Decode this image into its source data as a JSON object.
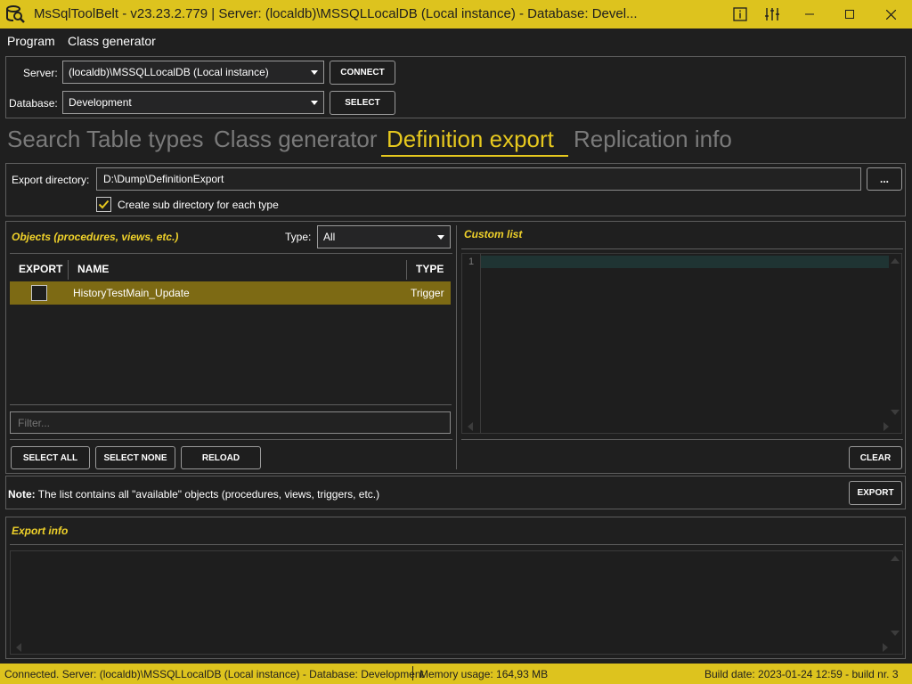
{
  "window": {
    "title": "MsSqlToolBelt - v23.23.2.779 | Server: (localdb)\\MSSQLLocalDB (Local instance) - Database: Devel...",
    "icons": [
      "app-logo-icon",
      "info-icon",
      "settings-sliders-icon",
      "minimize-icon",
      "maximize-icon",
      "close-icon"
    ]
  },
  "menu": {
    "items": [
      "Program",
      "Class generator"
    ]
  },
  "connection": {
    "server_label": "Server:",
    "server_value": "(localdb)\\MSSQLLocalDB (Local instance)",
    "connect_label": "CONNECT",
    "database_label": "Database:",
    "database_value": "Development",
    "select_label": "SELECT"
  },
  "tabs": [
    {
      "label": "Search",
      "active": false
    },
    {
      "label": "Table types",
      "active": false
    },
    {
      "label": "Class generator",
      "active": false
    },
    {
      "label": "Definition export",
      "active": true
    },
    {
      "label": "Replication info",
      "active": false
    }
  ],
  "export_dir": {
    "label": "Export directory:",
    "value": "D:\\Dump\\DefinitionExport",
    "browse_label": "...",
    "subdir_label": "Create sub directory for each type",
    "subdir_checked": true
  },
  "objects": {
    "title": "Objects (procedures, views, etc.)",
    "type_label": "Type:",
    "type_value": "All",
    "columns": [
      "EXPORT",
      "NAME",
      "TYPE"
    ],
    "rows": [
      {
        "export": false,
        "name": "HistoryTestMain_Update",
        "type": "Trigger",
        "selected": true
      }
    ],
    "filter_placeholder": "Filter...",
    "select_all": "SELECT ALL",
    "select_none": "SELECT NONE",
    "reload": "RELOAD"
  },
  "custom_list": {
    "title": "Custom list",
    "line_number": "1",
    "clear_label": "CLEAR"
  },
  "note": {
    "bold": "Note:",
    "text": " The list contains all \"available\" objects (procedures, views, triggers, etc.)",
    "export_label": "EXPORT"
  },
  "export_info": {
    "title": "Export info"
  },
  "statusbar": {
    "connection": "Connected. Server: (localdb)\\MSSQLLocalDB (Local instance) - Database: Development",
    "memory": "Memory usage: 164,93 MB",
    "build": "Build date: 2023-01-24 12:59 - build nr. 3"
  },
  "colors": {
    "accent": "#ddc31e",
    "background": "#1f1f1f",
    "selected_row": "#7d6a14"
  }
}
